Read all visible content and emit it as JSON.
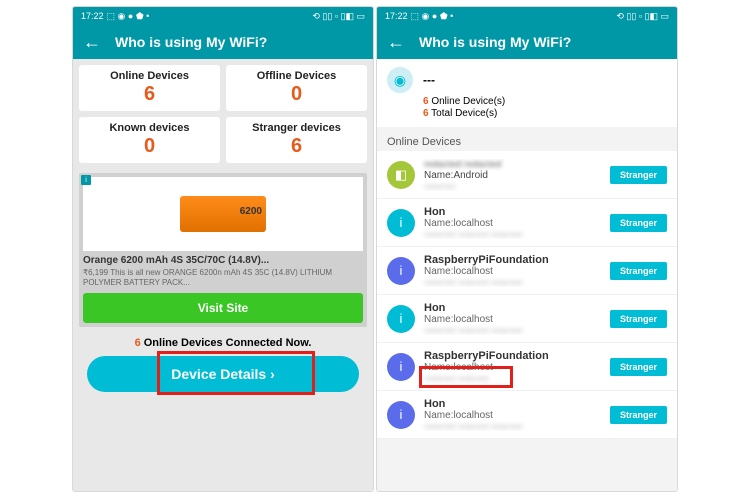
{
  "status": {
    "time": "17:22",
    "icons_left": "⬚ ◉ ● ⬟ •",
    "icons_right": "⟲ ▯▯ ▫ ▯◧ ▭"
  },
  "header": {
    "title": "Who is using My WiFi?"
  },
  "screen1": {
    "stats": [
      {
        "label": "Online Devices",
        "value": "6"
      },
      {
        "label": "Offline Devices",
        "value": "0"
      },
      {
        "label": "Known devices",
        "value": "0"
      },
      {
        "label": "Stranger devices",
        "value": "6"
      }
    ],
    "ad": {
      "title": "Orange 6200 mAh 4S 35C/70C (14.8V)...",
      "desc": "₹6,199 This is all new ORANGE 6200n mAh 4S 35C (14.8V) LITHIUM POLYMER BATTERY PACK...",
      "cta": "Visit Site"
    },
    "connected": {
      "count": "6",
      "text": "Online Devices Connected Now."
    },
    "details_btn": "Device Details ›"
  },
  "screen2": {
    "summary": {
      "ssid": "---",
      "online_count": "6",
      "online_label": "Online Device(s)",
      "total_count": "6",
      "total_label": "Total Device(s)"
    },
    "section": "Online Devices",
    "devices": [
      {
        "title": "redacted redacted",
        "name": "Name:Android",
        "ip": "redacted",
        "icon": "android"
      },
      {
        "title_clear": "Hon",
        "sub": "Name:localhost",
        "ip": "redacted redacted redacted",
        "icon": "cyan"
      },
      {
        "title_clear": "RaspberryPiFoundation",
        "sub": "Name:localhost",
        "ip": "redacted redacted redacted",
        "icon": "blue"
      },
      {
        "title_clear": "Hon",
        "sub": "Name:localhost",
        "ip": "redacted redacted redacted",
        "icon": "cyan"
      },
      {
        "title_clear": "RaspberryPiFoundation",
        "sub": "Name:localhost",
        "ip": "redacted redacted",
        "icon": "blue",
        "highlight": true
      },
      {
        "title_clear": "Hon",
        "sub": "Name:localhost",
        "ip": "redacted redacted redacted",
        "icon": "blue"
      }
    ],
    "stranger_label": "Stranger"
  }
}
